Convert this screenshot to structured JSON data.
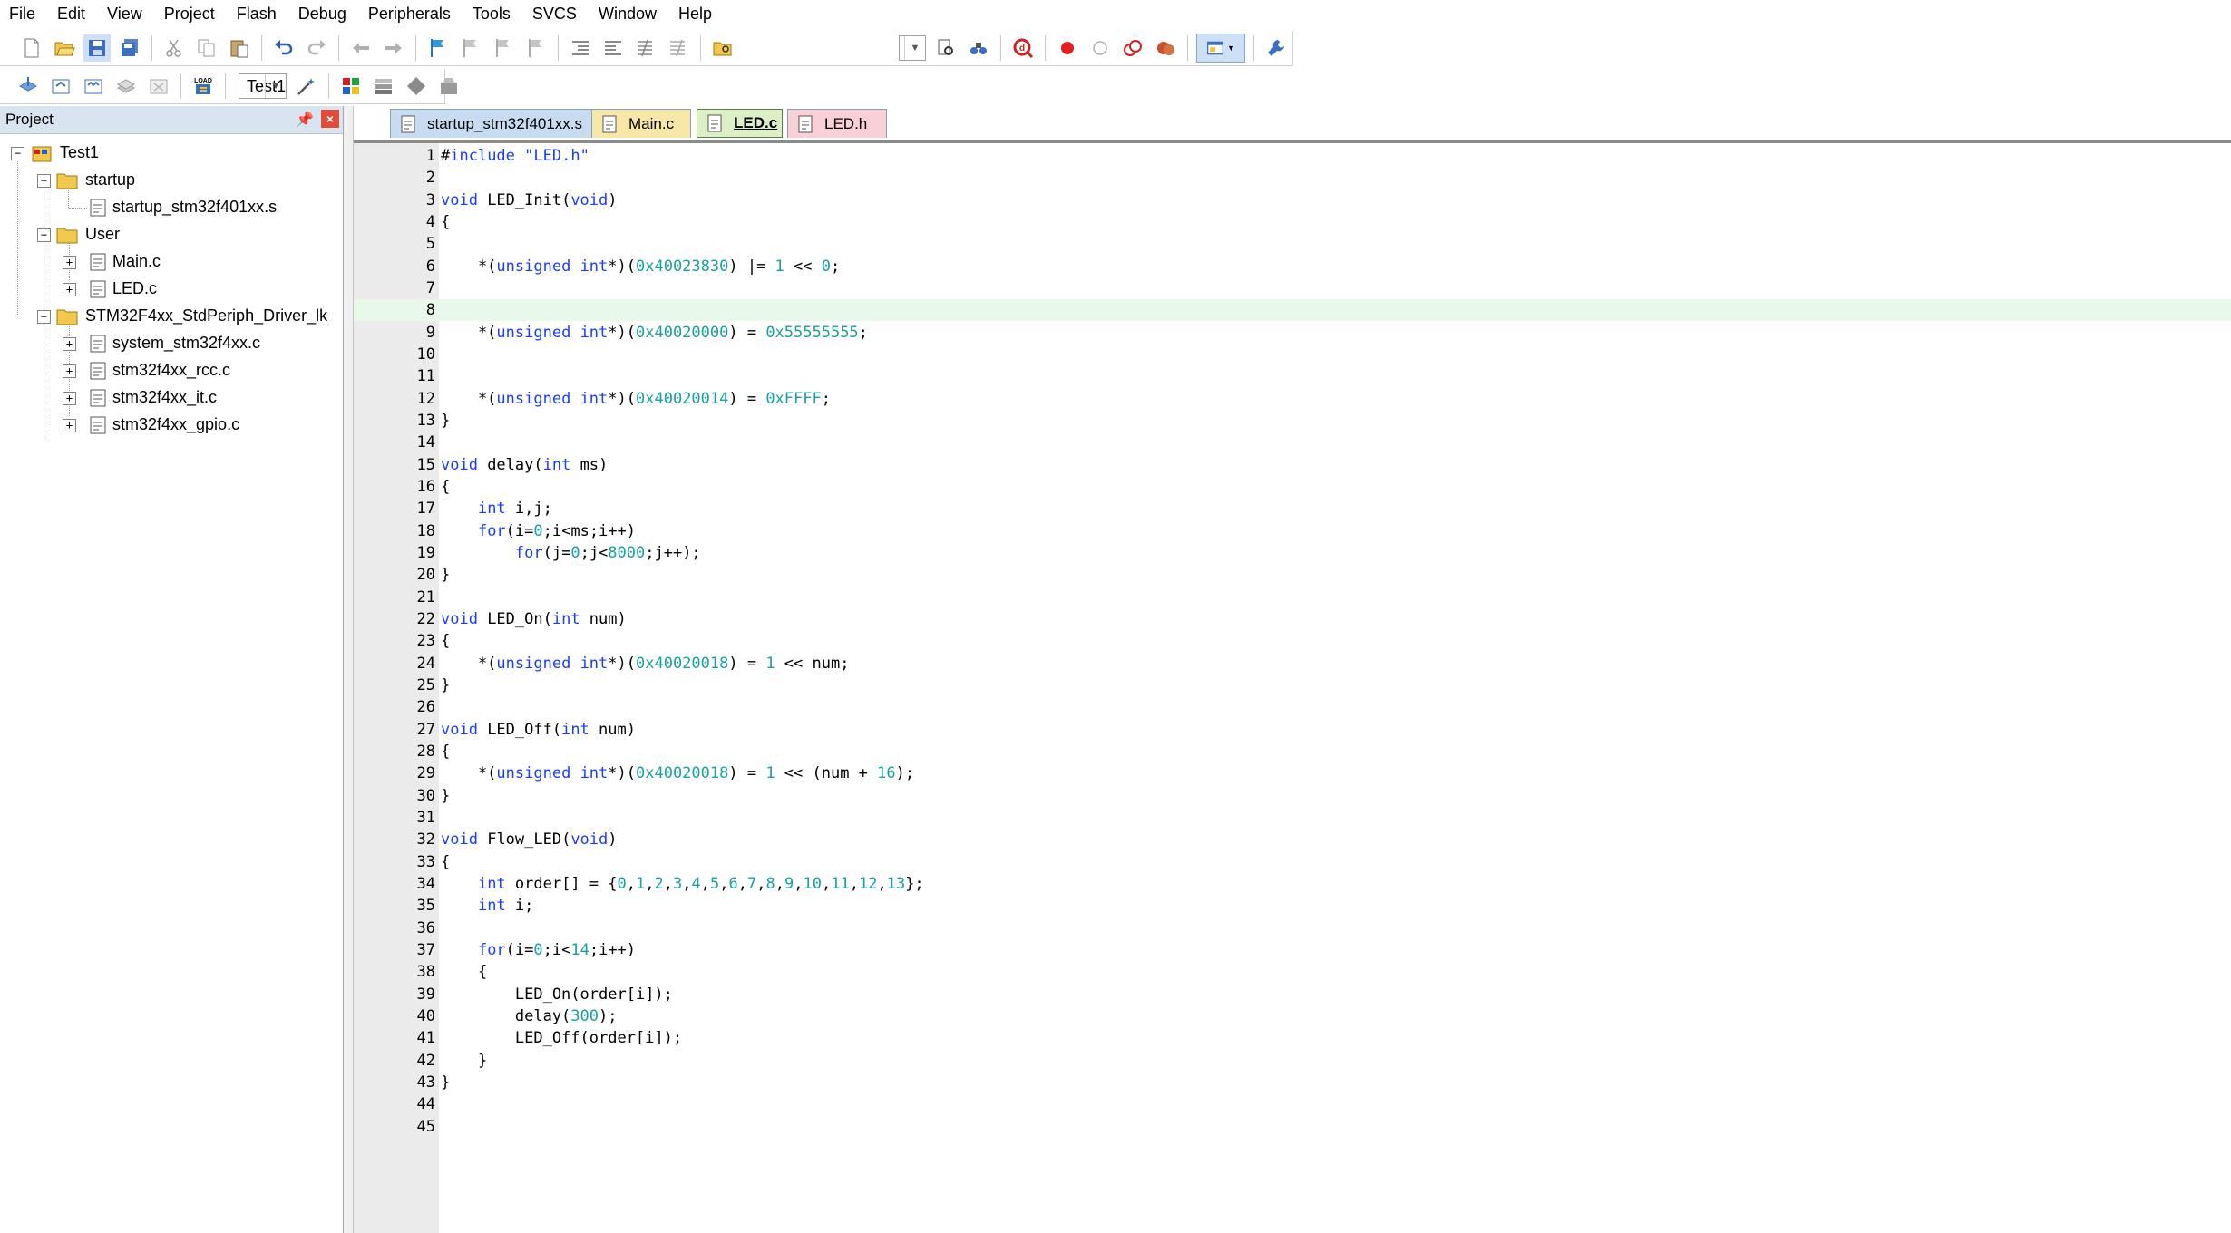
{
  "menu": [
    "File",
    "Edit",
    "View",
    "Project",
    "Flash",
    "Debug",
    "Peripherals",
    "Tools",
    "SVCS",
    "Window",
    "Help"
  ],
  "toolbar": {
    "target_value": "Test1",
    "find_value": ""
  },
  "project_panel": {
    "title": "Project",
    "tree": {
      "root": "Test1",
      "groups": [
        {
          "name": "startup",
          "files": [
            "startup_stm32f401xx.s"
          ]
        },
        {
          "name": "User",
          "files": [
            "Main.c",
            "LED.c"
          ]
        },
        {
          "name": "STM32F4xx_StdPeriph_Driver_lk",
          "files": [
            "system_stm32f4xx.c",
            "stm32f4xx_rcc.c",
            "stm32f4xx_it.c",
            "stm32f4xx_gpio.c"
          ]
        }
      ]
    }
  },
  "tabs": [
    {
      "label": "startup_stm32f401xx.s",
      "active": false
    },
    {
      "label": "Main.c",
      "active": false
    },
    {
      "label": "LED.c",
      "active": true
    },
    {
      "label": "LED.h",
      "active": false
    }
  ],
  "editor": {
    "current_line": 8,
    "lines": [
      "#include \"LED.h\"",
      "",
      "void LED_Init(void)",
      "{",
      "",
      "    *(unsigned int*)(0x40023830) |= 1 << 0;",
      "",
      "",
      "    *(unsigned int*)(0x40020000) = 0x55555555;",
      "",
      "",
      "    *(unsigned int*)(0x40020014) = 0xFFFF;",
      "}",
      "",
      "void delay(int ms)",
      "{",
      "    int i,j;",
      "    for(i=0;i<ms;i++)",
      "        for(j=0;j<8000;j++);",
      "}",
      "",
      "void LED_On(int num)",
      "{",
      "    *(unsigned int*)(0x40020018) = 1 << num;",
      "}",
      "",
      "void LED_Off(int num)",
      "{",
      "    *(unsigned int*)(0x40020018) = 1 << (num + 16);",
      "}",
      "",
      "void Flow_LED(void)",
      "{",
      "    int order[] = {0,1,2,3,4,5,6,7,8,9,10,11,12,13};",
      "    int i;",
      "",
      "    for(i=0;i<14;i++)",
      "    {",
      "        LED_On(order[i]);",
      "        delay(300);",
      "        LED_Off(order[i]);",
      "    }",
      "}",
      "",
      ""
    ]
  }
}
